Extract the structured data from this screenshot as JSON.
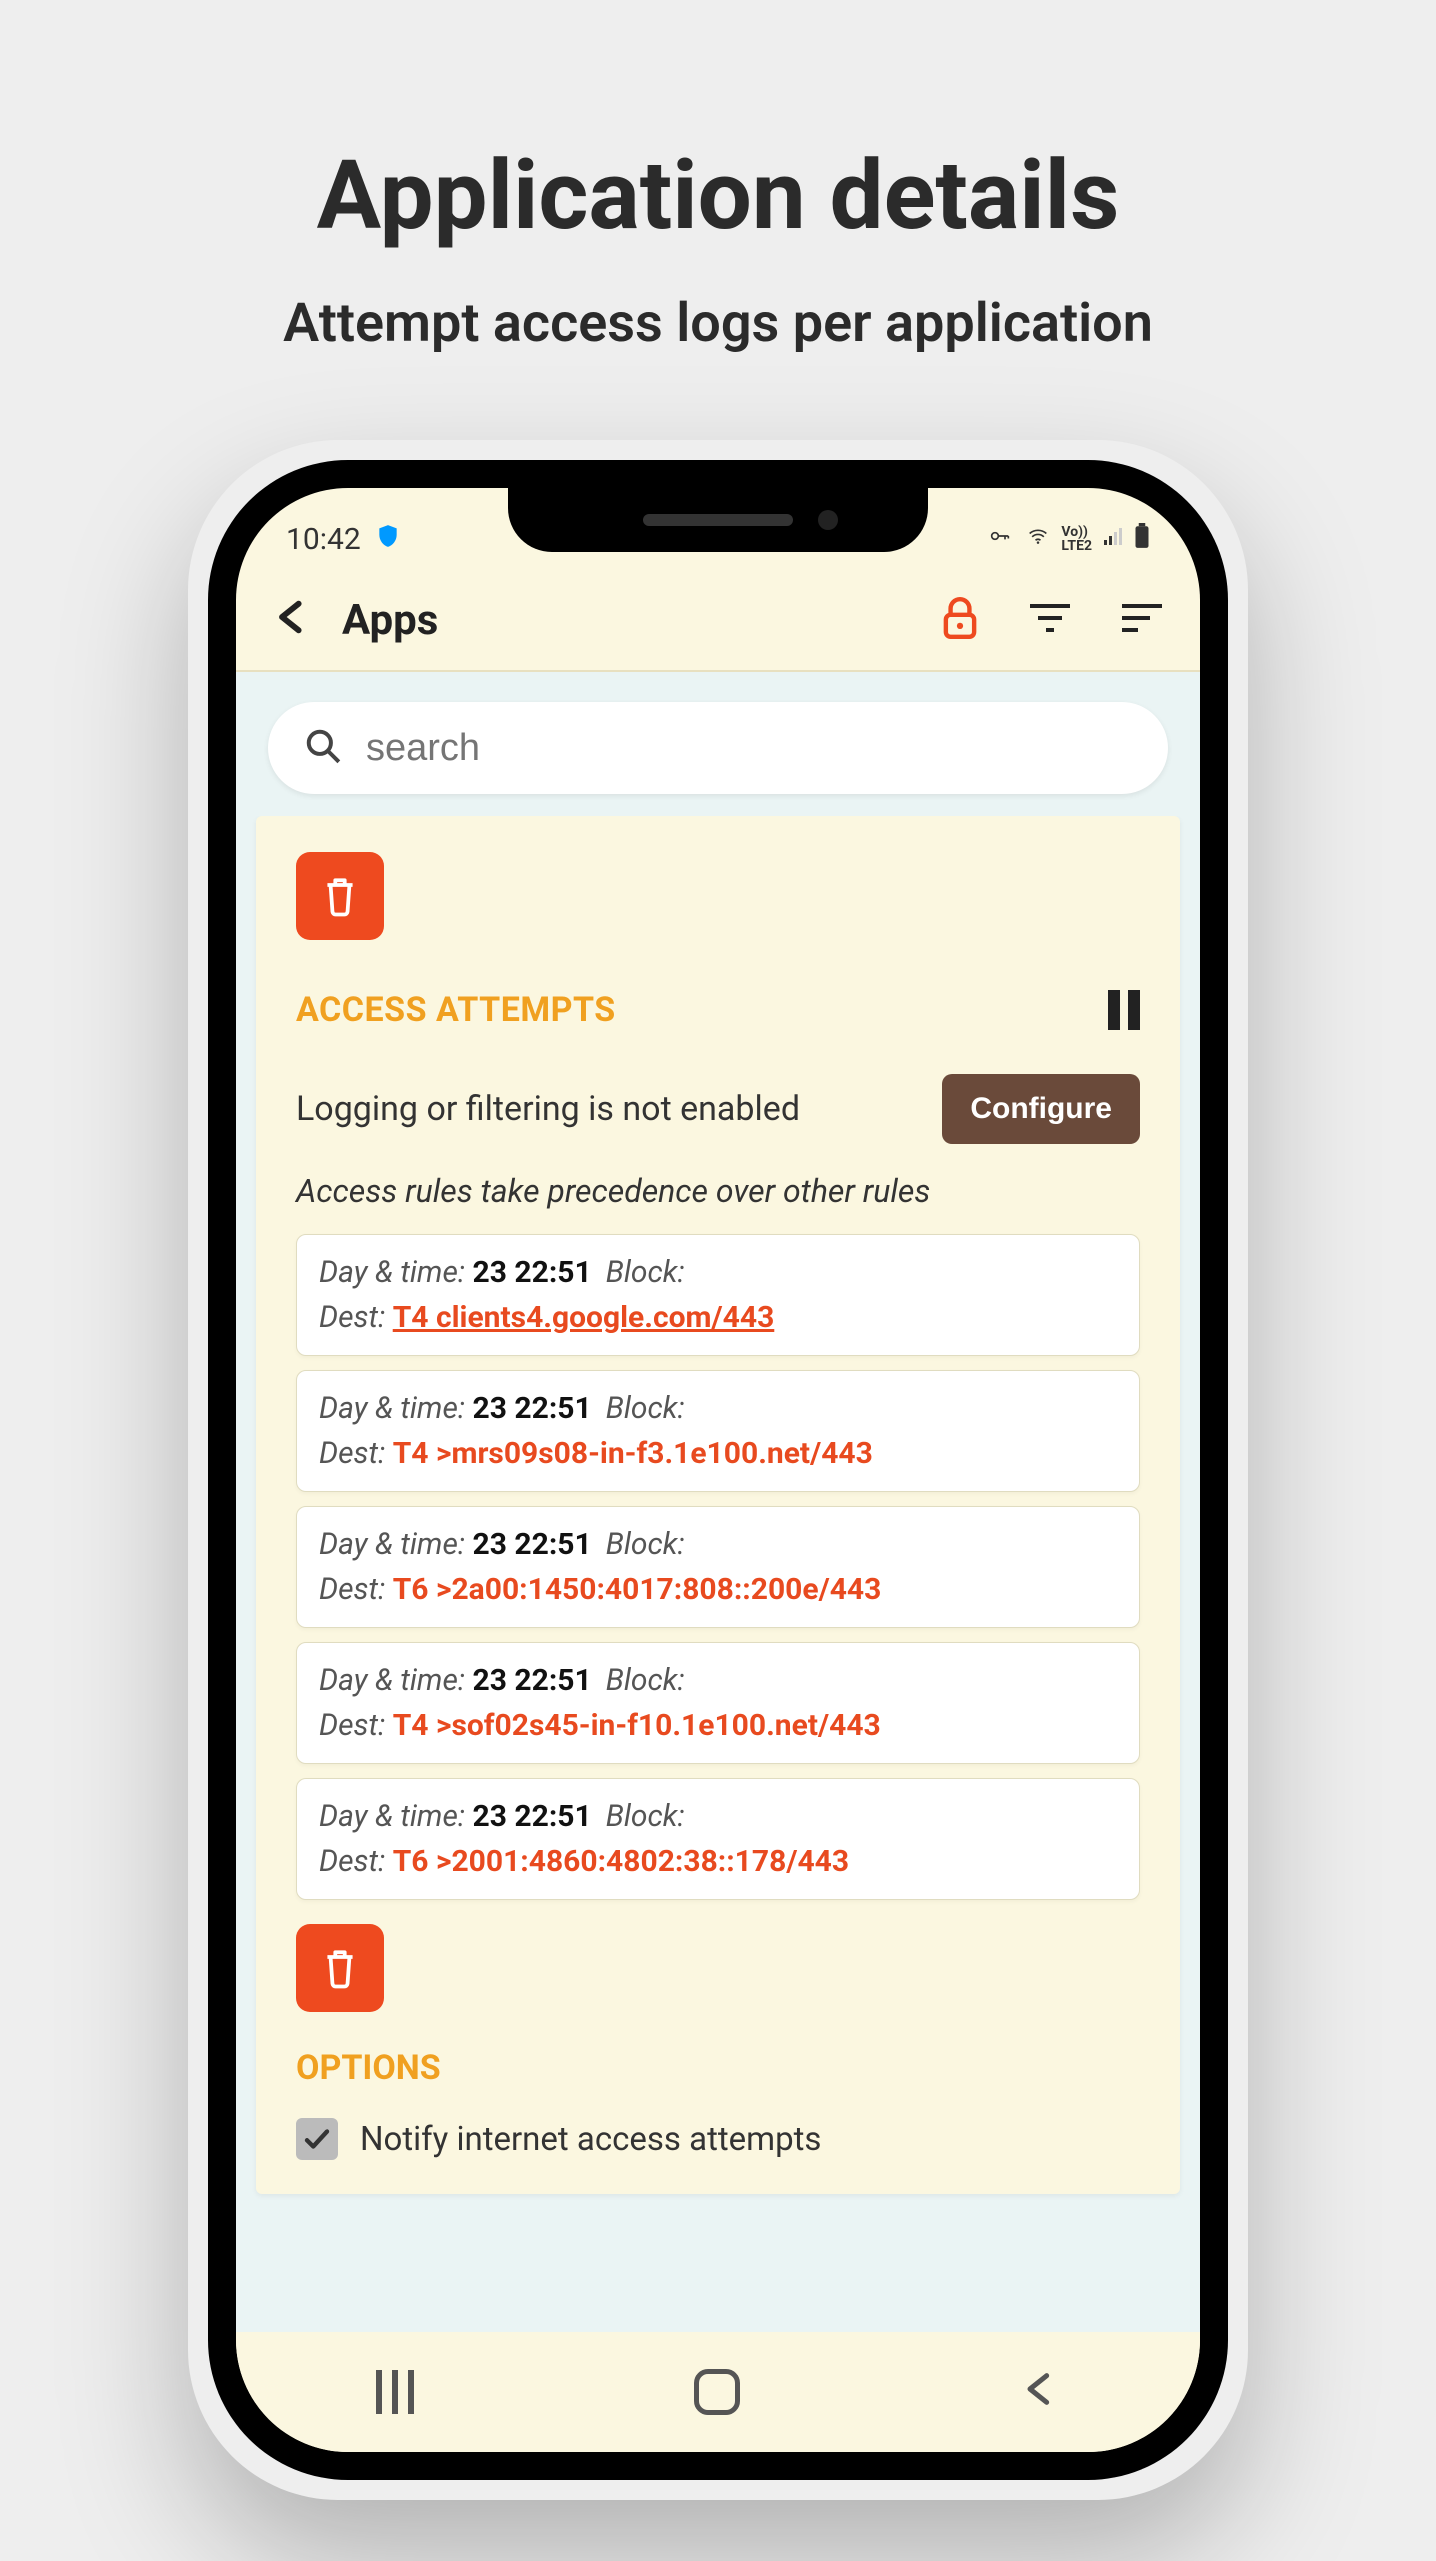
{
  "page": {
    "title": "Application details",
    "subtitle": "Attempt access logs per application"
  },
  "status": {
    "time": "10:42",
    "right": "⚿ 📶 LTE2 ▮"
  },
  "appbar": {
    "title": "Apps"
  },
  "search": {
    "placeholder": "search"
  },
  "section": {
    "access_attempts": "ACCESS ATTEMPTS",
    "config_text": "Logging or filtering is not enabled",
    "config_btn": "Configure",
    "precedence": "Access rules take precedence over other rules",
    "options": "OPTIONS"
  },
  "labels": {
    "daytime": "Day & time:",
    "block": "Block:",
    "dest": "Dest:"
  },
  "logs": [
    {
      "time": "23 22:51",
      "dest": "T4 clients4.google.com/443",
      "underline": true
    },
    {
      "time": "23 22:51",
      "dest": "T4 >mrs09s08-in-f3.1e100.net/443",
      "underline": false
    },
    {
      "time": "23 22:51",
      "dest": "T6 >2a00:1450:4017:808::200e/443",
      "underline": false
    },
    {
      "time": "23 22:51",
      "dest": "T4 >sof02s45-in-f10.1e100.net/443",
      "underline": false
    },
    {
      "time": "23 22:51",
      "dest": "T6 >2001:4860:4802:38::178/443",
      "underline": false
    }
  ],
  "option1": "Notify internet access attempts"
}
